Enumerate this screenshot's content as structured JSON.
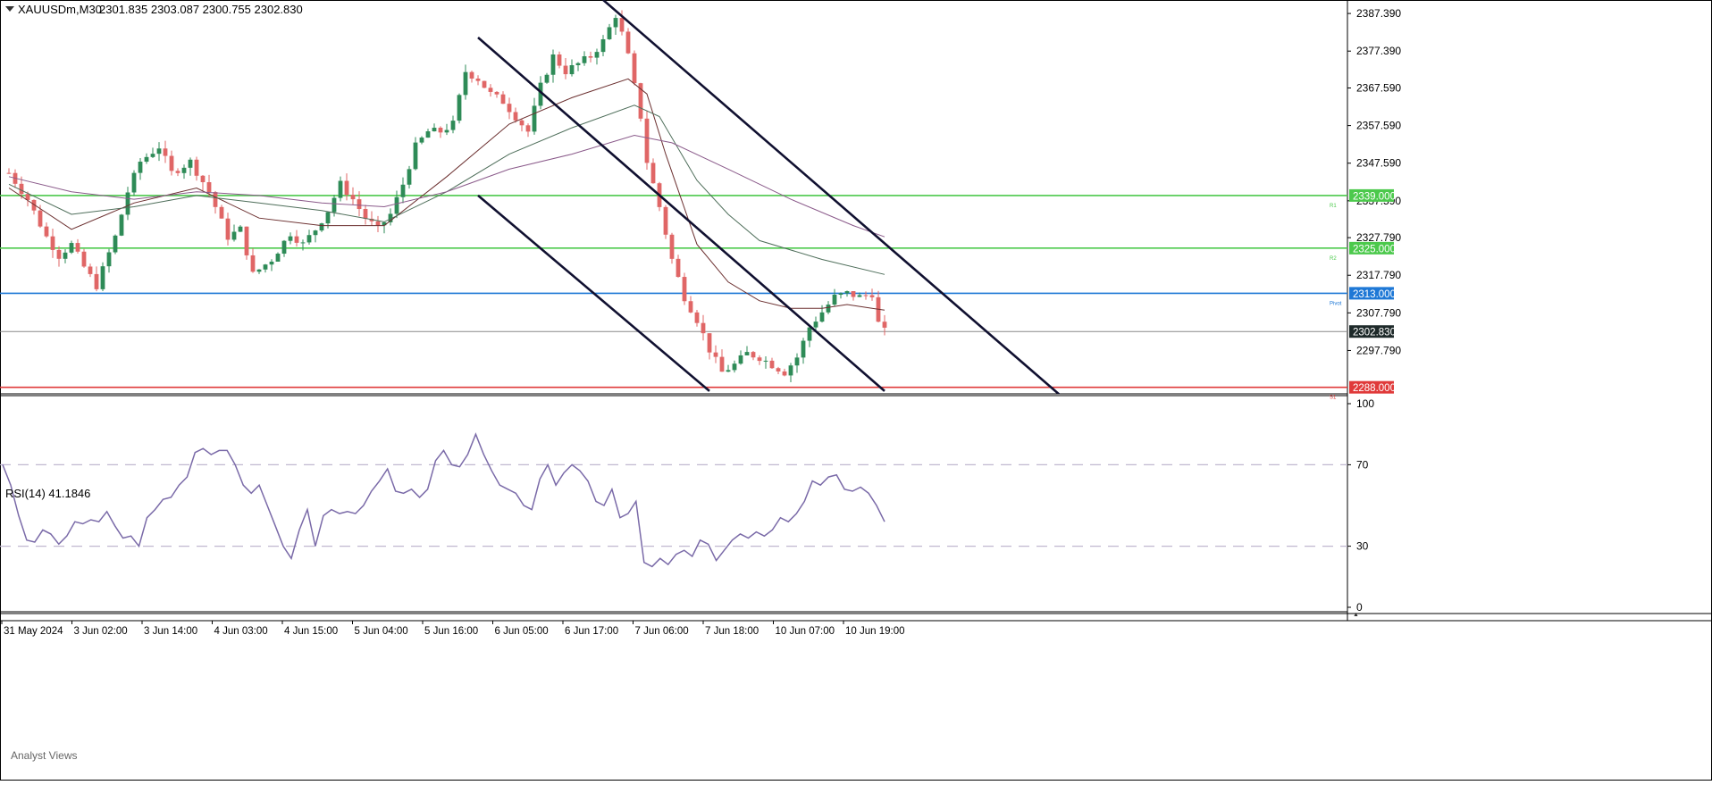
{
  "header": {
    "symbol": "XAUUSDm,M30",
    "ohlc": "2301.835 2303.087 2300.755 2302.830",
    "rsi_label": "RSI(14) 41.1846",
    "analyst_views": "Analyst Views"
  },
  "colors": {
    "bull": "#2e8b57",
    "bear": "#e06666",
    "channel": "#101030",
    "rsi": "#7a6aa8",
    "resistance": "#4cc94c",
    "pivot": "#1e78d6",
    "support": "#e03a3a",
    "price_line": "#888888",
    "ma_fast": "#6b2f2f",
    "ma_mid": "#4e6e5a",
    "ma_slow": "#8a5a8a"
  },
  "chart_data": [
    {
      "type": "candlestick",
      "title": "XAUUSDm,M30",
      "x_ticks": [
        "31 May 2024",
        "3 Jun 02:00",
        "3 Jun 14:00",
        "4 Jun 03:00",
        "4 Jun 15:00",
        "5 Jun 04:00",
        "5 Jun 16:00",
        "6 Jun 05:00",
        "6 Jun 17:00",
        "7 Jun 06:00",
        "7 Jun 18:00",
        "10 Jun 07:00",
        "10 Jun 19:00"
      ],
      "y_ticks": [
        "2387.390",
        "2377.390",
        "2367.590",
        "2357.590",
        "2347.590",
        "2337.590",
        "2327.790",
        "2317.790",
        "2307.790",
        "2297.790"
      ],
      "ylim": [
        2286.5,
        2390.5
      ],
      "last_price": 2302.83,
      "last_price_label": "2302.830",
      "levels": [
        {
          "name": "R1",
          "label": "2339.000",
          "value": 2339.0,
          "kind": "resistance"
        },
        {
          "name": "R2",
          "label": "2325.000",
          "value": 2325.0,
          "kind": "resistance"
        },
        {
          "name": "Pivot",
          "label": "2313.000",
          "value": 2313.0,
          "kind": "pivot"
        },
        {
          "name": "S1",
          "label": "2288.000",
          "value": 2288.0,
          "kind": "support"
        }
      ],
      "price_path": [
        [
          0,
          2345
        ],
        [
          3,
          2338
        ],
        [
          6,
          2328
        ],
        [
          8,
          2323
        ],
        [
          10,
          2326
        ],
        [
          12,
          2320
        ],
        [
          14,
          2315
        ],
        [
          17,
          2328
        ],
        [
          19,
          2340
        ],
        [
          21,
          2348
        ],
        [
          24,
          2352
        ],
        [
          26,
          2345
        ],
        [
          29,
          2348
        ],
        [
          32,
          2340
        ],
        [
          35,
          2328
        ],
        [
          37,
          2330
        ],
        [
          39,
          2318
        ],
        [
          42,
          2322
        ],
        [
          45,
          2329
        ],
        [
          47,
          2326
        ],
        [
          49,
          2330
        ],
        [
          51,
          2335
        ],
        [
          53,
          2342
        ],
        [
          55,
          2338
        ],
        [
          57,
          2333
        ],
        [
          59,
          2330
        ],
        [
          61,
          2334
        ],
        [
          63,
          2342
        ],
        [
          65,
          2352
        ],
        [
          67,
          2356
        ],
        [
          69,
          2356
        ],
        [
          71,
          2358
        ],
        [
          73,
          2372
        ],
        [
          75,
          2370
        ],
        [
          77,
          2366
        ],
        [
          79,
          2364
        ],
        [
          81,
          2360
        ],
        [
          83,
          2356
        ],
        [
          85,
          2368
        ],
        [
          87,
          2376
        ],
        [
          89,
          2372
        ],
        [
          91,
          2374
        ],
        [
          93,
          2376
        ],
        [
          95,
          2380
        ],
        [
          97,
          2387
        ],
        [
          98,
          2382
        ],
        [
          99,
          2376
        ],
        [
          101,
          2360
        ],
        [
          102,
          2348
        ],
        [
          104,
          2336
        ],
        [
          106,
          2322
        ],
        [
          108,
          2312
        ],
        [
          110,
          2306
        ],
        [
          112,
          2298
        ],
        [
          114,
          2292
        ],
        [
          116,
          2294
        ],
        [
          118,
          2297
        ],
        [
          120,
          2296
        ],
        [
          122,
          2294
        ],
        [
          124,
          2292
        ],
        [
          126,
          2296
        ],
        [
          128,
          2304
        ],
        [
          130,
          2308
        ],
        [
          132,
          2312
        ],
        [
          134,
          2313
        ],
        [
          136,
          2312
        ],
        [
          138,
          2313
        ],
        [
          139,
          2305
        ],
        [
          140,
          2302.83
        ]
      ],
      "x_count": 141,
      "channels": [
        {
          "name": "channel-outer-upper",
          "p1": [
            95,
            2391
          ],
          "p2": [
            168,
            2286
          ]
        },
        {
          "name": "channel-mid",
          "p1": [
            75,
            2381
          ],
          "p2": [
            140,
            2287
          ]
        },
        {
          "name": "channel-lower",
          "p1": [
            75,
            2339
          ],
          "p2": [
            112,
            2287
          ]
        }
      ],
      "moving_averages": [
        {
          "name": "ma-fast",
          "path": [
            [
              0,
              2341
            ],
            [
              10,
              2330
            ],
            [
              20,
              2337
            ],
            [
              30,
              2341
            ],
            [
              40,
              2333
            ],
            [
              50,
              2331
            ],
            [
              60,
              2331
            ],
            [
              70,
              2344
            ],
            [
              80,
              2358
            ],
            [
              90,
              2365
            ],
            [
              99,
              2370
            ],
            [
              102,
              2366
            ],
            [
              105,
              2350
            ],
            [
              110,
              2326
            ],
            [
              115,
              2316
            ],
            [
              120,
              2311
            ],
            [
              125,
              2309
            ],
            [
              130,
              2309
            ],
            [
              134,
              2310
            ],
            [
              138,
              2309
            ],
            [
              140,
              2308.5
            ]
          ]
        },
        {
          "name": "ma-mid",
          "path": [
            [
              0,
              2342
            ],
            [
              10,
              2334
            ],
            [
              20,
              2336
            ],
            [
              30,
              2339
            ],
            [
              40,
              2337
            ],
            [
              50,
              2335
            ],
            [
              60,
              2332
            ],
            [
              70,
              2340
            ],
            [
              80,
              2350
            ],
            [
              90,
              2357
            ],
            [
              100,
              2363
            ],
            [
              104,
              2360
            ],
            [
              110,
              2343
            ],
            [
              115,
              2334
            ],
            [
              120,
              2327
            ],
            [
              130,
              2322
            ],
            [
              140,
              2318
            ]
          ]
        },
        {
          "name": "ma-slow",
          "path": [
            [
              0,
              2344
            ],
            [
              10,
              2340
            ],
            [
              20,
              2338
            ],
            [
              30,
              2340
            ],
            [
              40,
              2339
            ],
            [
              50,
              2337
            ],
            [
              60,
              2336
            ],
            [
              70,
              2340
            ],
            [
              80,
              2346
            ],
            [
              90,
              2350
            ],
            [
              100,
              2355
            ],
            [
              106,
              2353
            ],
            [
              115,
              2346
            ],
            [
              125,
              2338
            ],
            [
              135,
              2331
            ],
            [
              140,
              2328
            ]
          ]
        }
      ]
    },
    {
      "type": "line",
      "title": "RSI(14) 41.1846",
      "ylim": [
        0,
        100
      ],
      "y_ticks": [
        "100",
        "70",
        "30",
        "0"
      ],
      "levels": [
        70,
        30
      ],
      "series": [
        {
          "values": [
            70,
            60,
            45,
            33,
            32,
            38,
            36,
            31,
            35,
            42,
            41,
            43,
            42,
            47,
            40,
            34,
            35,
            30,
            44,
            48,
            53,
            54,
            60,
            64,
            76,
            78,
            75,
            77,
            77,
            70,
            60,
            56,
            60,
            50,
            40,
            30,
            24,
            38,
            48,
            30,
            45,
            48,
            46,
            47,
            46,
            50,
            57,
            62,
            68,
            57,
            56,
            58,
            54,
            58,
            72,
            77,
            70,
            69,
            75,
            85,
            75,
            67,
            60,
            58,
            56,
            50,
            48,
            63,
            70,
            60,
            66,
            70,
            67,
            62,
            52,
            50,
            58,
            44,
            46,
            52,
            22,
            20,
            24,
            21,
            26,
            28,
            25,
            33,
            31,
            23,
            28,
            33,
            36,
            34,
            37,
            35,
            38,
            44,
            42,
            46,
            52,
            62,
            60,
            64,
            65,
            58,
            57,
            59,
            56,
            50,
            42
          ]
        }
      ]
    }
  ]
}
